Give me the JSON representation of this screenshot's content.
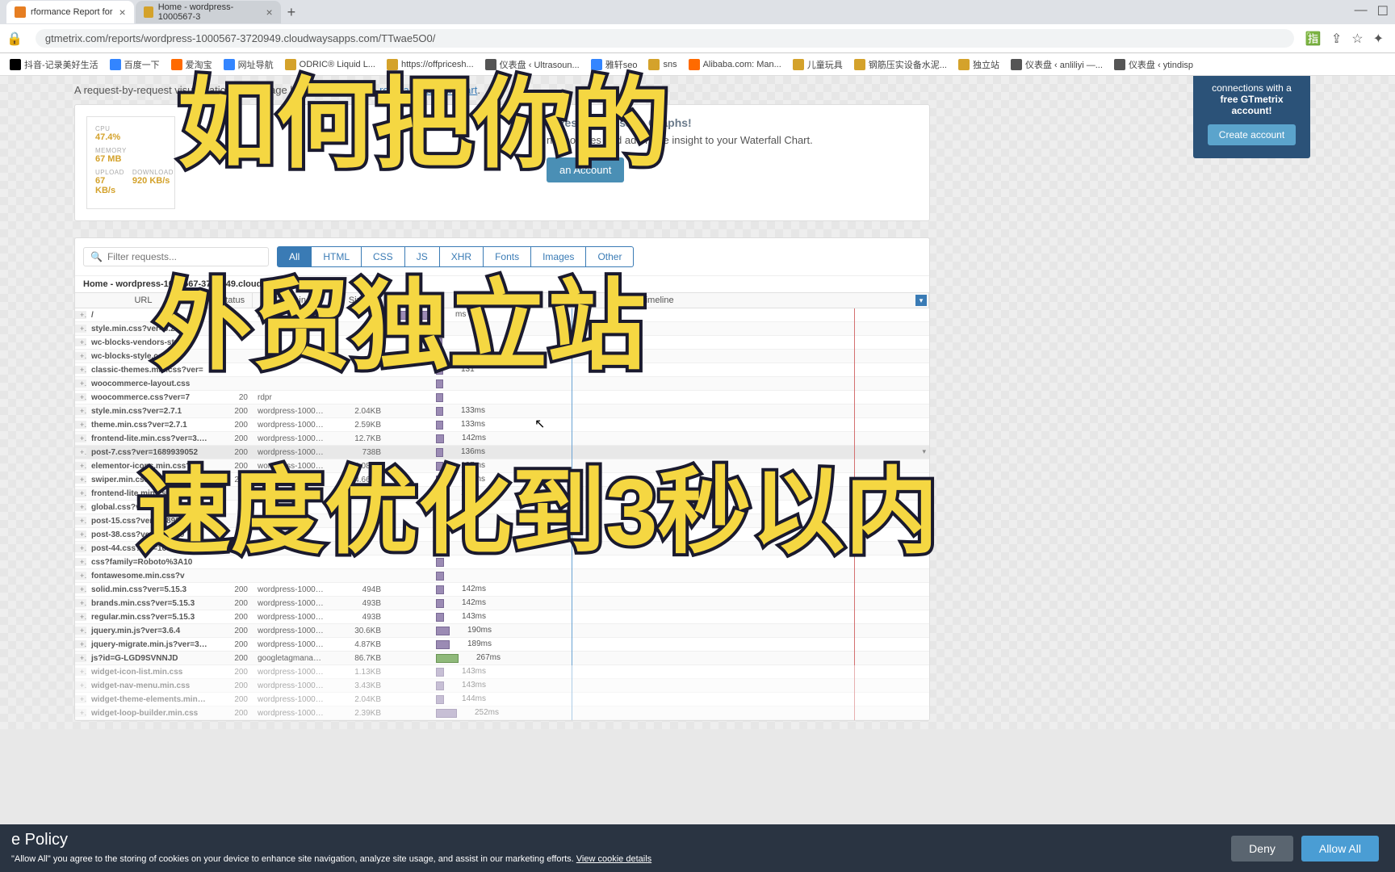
{
  "tabs": [
    {
      "title": "rformance Report for",
      "icon": "#e67e22"
    },
    {
      "title": "Home - wordpress-1000567-3",
      "icon": "#d4a22b"
    }
  ],
  "url": "gtmetrix.com/reports/wordpress-1000567-3720949.cloudwaysapps.com/TTwae5O0/",
  "bookmarks": [
    {
      "label": "抖音-记录美好生活",
      "color": "#000"
    },
    {
      "label": "百度一下",
      "color": "#3385ff"
    },
    {
      "label": "爱淘宝",
      "color": "#ff6a00"
    },
    {
      "label": "网址导航",
      "color": "#3385ff"
    },
    {
      "label": "ODRIC® Liquid L...",
      "color": "#d4a22b"
    },
    {
      "label": "https://offpricesh...",
      "color": "#d4a22b"
    },
    {
      "label": "仪表盘 ‹ Ultrasoun...",
      "color": "#555"
    },
    {
      "label": "雅轩seo",
      "color": "#3385ff"
    },
    {
      "label": "sns",
      "color": "#d4a22b"
    },
    {
      "label": "Alibaba.com: Man...",
      "color": "#ff6a00"
    },
    {
      "label": "儿童玩具",
      "color": "#d4a22b"
    },
    {
      "label": "钢筋压实设备水泥...",
      "color": "#d4a22b"
    },
    {
      "label": "独立站",
      "color": "#d4a22b"
    },
    {
      "label": "仪表盘 ‹ anliliyi —...",
      "color": "#555"
    },
    {
      "label": "仪表盘 ‹ ytindisp",
      "color": "#555"
    }
  ],
  "intro": {
    "text": "A request-by-request visualization of the page load. ",
    "link": "Learn how to read a waterfall chart"
  },
  "mini": {
    "cpu_label": "CPU",
    "cpu": "47.4%",
    "mem_label": "MEMORY",
    "mem": "67 MB",
    "up_label": "UPLOAD",
    "up": "67 KB/s",
    "dl_label": "DOWNLOAD",
    "dl": "920 KB/s"
  },
  "promo": {
    "title": "o Resource Usage Graphs!",
    "text": "n resources and add more insight to your Waterfall Chart.",
    "btn": "an Account"
  },
  "side": {
    "text": "connections with a",
    "bold": "free GTmetrix account!",
    "btn": "Create account"
  },
  "filter_placeholder": "Filter requests...",
  "filter_tabs": [
    "All",
    "HTML",
    "CSS",
    "JS",
    "XHR",
    "Fonts",
    "Images",
    "Other"
  ],
  "wf_title": "Home - wordpress-1000567-3720949.cloudwaysapps",
  "headers": {
    "url": "URL",
    "status": "Status",
    "domain": "Domain",
    "size": "Size",
    "timeline": "Timeline"
  },
  "rows": [
    {
      "url": "/",
      "status": "",
      "domain": "rdpr",
      "size": "",
      "time": "ms",
      "bl": 0,
      "bw": 62,
      "tl": 66
    },
    {
      "url": "style.min.css?ver=6.2.2",
      "status": "",
      "domain": "",
      "size": "",
      "time": "",
      "bl": 62,
      "bw": 8,
      "tl": 72
    },
    {
      "url": "wc-blocks-vendors-style.",
      "status": "",
      "domain": "",
      "size": "",
      "time": "",
      "bl": 62,
      "bw": 8,
      "tl": 72
    },
    {
      "url": "wc-blocks-style.css?ver",
      "status": "",
      "domain": "",
      "size": "",
      "time": "13",
      "bl": 62,
      "bw": 9,
      "tl": 73
    },
    {
      "url": "classic-themes.min.css?ver=",
      "status": "",
      "domain": "",
      "size": "",
      "time": "131",
      "bl": 62,
      "bw": 9,
      "tl": 73
    },
    {
      "url": "woocommerce-layout.css",
      "status": "",
      "domain": "",
      "size": "",
      "time": "",
      "bl": 62,
      "bw": 9,
      "tl": 73
    },
    {
      "url": "woocommerce.css?ver=7",
      "status": "20",
      "domain": "rdpr",
      "size": "",
      "time": "",
      "bl": 62,
      "bw": 9,
      "tl": 73
    },
    {
      "url": "style.min.css?ver=2.7.1",
      "status": "200",
      "domain": "wordpress-100056...",
      "size": "2.04KB",
      "time": "133ms",
      "bl": 62,
      "bw": 9,
      "tl": 73
    },
    {
      "url": "theme.min.css?ver=2.7.1",
      "status": "200",
      "domain": "wordpress-100056...",
      "size": "2.59KB",
      "time": "133ms",
      "bl": 62,
      "bw": 9,
      "tl": 73
    },
    {
      "url": "frontend-lite.min.css?ver=3.14.1",
      "status": "200",
      "domain": "wordpress-100056...",
      "size": "12.7KB",
      "time": "142ms",
      "bl": 62,
      "bw": 10,
      "tl": 74
    },
    {
      "url": "post-7.css?ver=1689939052",
      "status": "200",
      "domain": "wordpress-100056...",
      "size": "738B",
      "time": "136ms",
      "bl": 62,
      "bw": 9,
      "tl": 73,
      "sel": true
    },
    {
      "url": "elementor-icons.min.css?ver...",
      "status": "200",
      "domain": "wordpress-100056...",
      "size": "4.08KB",
      "time": "137ms",
      "bl": 62,
      "bw": 9,
      "tl": 73
    },
    {
      "url": "swiper.min.css?ver=8.4.5",
      "status": "200",
      "domain": "wordpress-100056...",
      "size": "4.66KB",
      "time": "138ms",
      "bl": 62,
      "bw": 9,
      "tl": 73
    },
    {
      "url": "frontend-lite.min.css?ve",
      "status": "",
      "domain": "100",
      "size": "70KB",
      "time": "13",
      "bl": 62,
      "bw": 9,
      "tl": 73
    },
    {
      "url": "global.css?ver=168993905",
      "status": "",
      "domain": "",
      "size": "",
      "time": "",
      "bl": 62,
      "bw": 9,
      "tl": 73
    },
    {
      "url": "post-15.css?ver=168993",
      "status": "",
      "domain": "",
      "size": "",
      "time": "",
      "bl": 62,
      "bw": 9,
      "tl": 73
    },
    {
      "url": "post-38.css?ver=169019",
      "status": "",
      "domain": "",
      "size": "",
      "time": "",
      "bl": 62,
      "bw": 9,
      "tl": 73
    },
    {
      "url": "post-44.css?ver=16901910",
      "status": "",
      "domain": "",
      "size": "",
      "time": "",
      "bl": 62,
      "bw": 9,
      "tl": 73
    },
    {
      "url": "css?family=Roboto%3A10",
      "status": "",
      "domain": "",
      "size": "",
      "time": "",
      "bl": 62,
      "bw": 10,
      "tl": 74
    },
    {
      "url": "fontawesome.min.css?v",
      "status": "",
      "domain": "",
      "size": "",
      "time": "",
      "bl": 62,
      "bw": 10,
      "tl": 74
    },
    {
      "url": "solid.min.css?ver=5.15.3",
      "status": "200",
      "domain": "wordpress-100056...",
      "size": "494B",
      "time": "142ms",
      "bl": 62,
      "bw": 10,
      "tl": 74
    },
    {
      "url": "brands.min.css?ver=5.15.3",
      "status": "200",
      "domain": "wordpress-100056...",
      "size": "493B",
      "time": "142ms",
      "bl": 62,
      "bw": 10,
      "tl": 74
    },
    {
      "url": "regular.min.css?ver=5.15.3",
      "status": "200",
      "domain": "wordpress-100056...",
      "size": "493B",
      "time": "143ms",
      "bl": 62,
      "bw": 10,
      "tl": 74
    },
    {
      "url": "jquery.min.js?ver=3.6.4",
      "status": "200",
      "domain": "wordpress-100056...",
      "size": "30.6KB",
      "time": "190ms",
      "bl": 62,
      "bw": 17,
      "tl": 81
    },
    {
      "url": "jquery-migrate.min.js?ver=3.4.0",
      "status": "200",
      "domain": "wordpress-100056...",
      "size": "4.87KB",
      "time": "189ms",
      "bl": 62,
      "bw": 17,
      "tl": 81
    },
    {
      "url": "js?id=G-LGD9SVNNJD",
      "status": "200",
      "domain": "googletagmanager...",
      "size": "86.7KB",
      "time": "267ms",
      "bl": 62,
      "bw": 28,
      "tl": 92,
      "green": true
    },
    {
      "url": "widget-icon-list.min.css",
      "status": "200",
      "domain": "wordpress-100056...",
      "size": "1.13KB",
      "time": "143ms",
      "bl": 62,
      "bw": 10,
      "tl": 74,
      "dim": true
    },
    {
      "url": "widget-nav-menu.min.css",
      "status": "200",
      "domain": "wordpress-100056...",
      "size": "3.43KB",
      "time": "143ms",
      "bl": 62,
      "bw": 10,
      "tl": 74,
      "dim": true
    },
    {
      "url": "widget-theme-elements.min.css",
      "status": "200",
      "domain": "wordpress-100056...",
      "size": "2.04KB",
      "time": "144ms",
      "bl": 62,
      "bw": 10,
      "tl": 74,
      "dim": true
    },
    {
      "url": "widget-loop-builder.min.css",
      "status": "200",
      "domain": "wordpress-100056...",
      "size": "2.39KB",
      "time": "252ms",
      "bl": 62,
      "bw": 26,
      "tl": 90,
      "dim": true
    }
  ],
  "overlay": {
    "l1": "如何把你的",
    "l2": "外贸独立站",
    "l3": "速度优化到3秒以内"
  },
  "cookie": {
    "title": "e Policy",
    "text": "\"Allow All\" you agree to the storing of cookies on your device to enhance site navigation, analyze site usage, and assist in our marketing efforts. ",
    "link": "View cookie details",
    "deny": "Deny",
    "allow": "Allow All"
  }
}
